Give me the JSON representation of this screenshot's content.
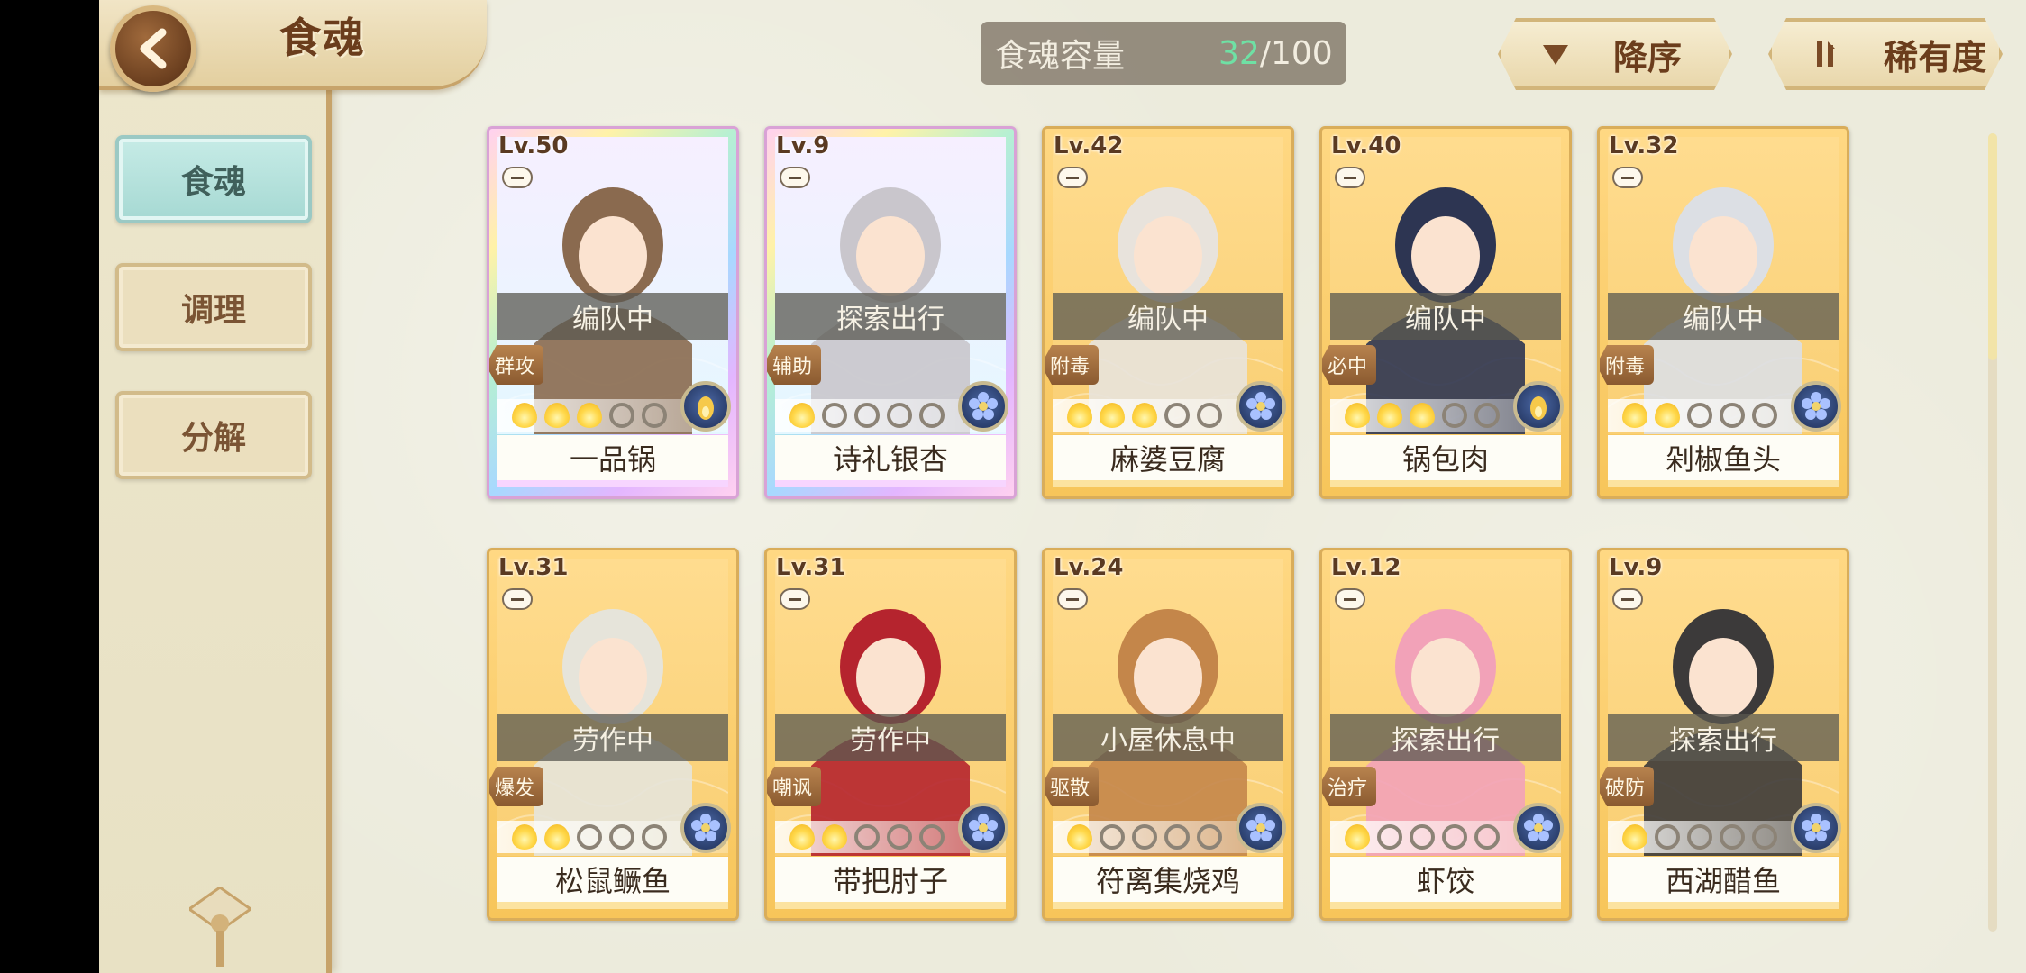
{
  "header": {
    "title": "食魂"
  },
  "sidebar": {
    "tabs": [
      {
        "label": "食魂",
        "active": true
      },
      {
        "label": "调理",
        "active": false
      },
      {
        "label": "分解",
        "active": false
      }
    ]
  },
  "capacity": {
    "label": "食魂容量",
    "current": "32",
    "separator": "/",
    "max": "100"
  },
  "toolbar": {
    "sort_order_label": "降序",
    "sort_order_icon": "triangle-down-icon",
    "sort_field_label": "稀有度",
    "sort_field_icon": "swap-vertical-icon"
  },
  "scrollbar": {
    "position": 0.0
  },
  "colors": {
    "accent_teal": "#a6d9d3",
    "gold": "#f7c55a",
    "brown_text": "#6b3d1c",
    "capacity_green": "#6fe0a4"
  },
  "cards": [
    {
      "level": "Lv.50",
      "status": "编队中",
      "role": "群攻",
      "stars": 3,
      "max_stars": 5,
      "name": "一品锅",
      "frame": "rainbow",
      "emblem": "flame-emblem-icon",
      "art_color": "#8a6a4f"
    },
    {
      "level": "Lv.9",
      "status": "探索出行",
      "role": "辅助",
      "stars": 1,
      "max_stars": 5,
      "name": "诗礼银杏",
      "frame": "rainbow",
      "emblem": "flower-emblem-icon",
      "art_color": "#c9c6cc"
    },
    {
      "level": "Lv.42",
      "status": "编队中",
      "role": "附毒",
      "stars": 3,
      "max_stars": 5,
      "name": "麻婆豆腐",
      "frame": "gold",
      "emblem": "flower-emblem-icon",
      "art_color": "#e8e3dc"
    },
    {
      "level": "Lv.40",
      "status": "编队中",
      "role": "必中",
      "stars": 3,
      "max_stars": 5,
      "name": "锅包肉",
      "frame": "gold",
      "emblem": "flame-emblem-icon",
      "art_color": "#2d3552"
    },
    {
      "level": "Lv.32",
      "status": "编队中",
      "role": "附毒",
      "stars": 2,
      "max_stars": 5,
      "name": "剁椒鱼头",
      "frame": "gold",
      "emblem": "flower-emblem-icon",
      "art_color": "#dcdfe4"
    },
    {
      "level": "Lv.31",
      "status": "劳作中",
      "role": "爆发",
      "stars": 2,
      "max_stars": 5,
      "name": "松鼠鳜鱼",
      "frame": "gold",
      "emblem": "flower-emblem-icon",
      "art_color": "#e6e4da"
    },
    {
      "level": "Lv.31",
      "status": "劳作中",
      "role": "嘲讽",
      "stars": 2,
      "max_stars": 5,
      "name": "带把肘子",
      "frame": "gold",
      "emblem": "flower-emblem-icon",
      "art_color": "#b5242e"
    },
    {
      "level": "Lv.24",
      "status": "小屋休息中",
      "role": "驱散",
      "stars": 1,
      "max_stars": 5,
      "name": "符离集烧鸡",
      "frame": "gold",
      "emblem": "flower-emblem-icon",
      "art_color": "#c4864a"
    },
    {
      "level": "Lv.12",
      "status": "探索出行",
      "role": "治疗",
      "stars": 1,
      "max_stars": 5,
      "name": "虾饺",
      "frame": "gold",
      "emblem": "flower-emblem-icon",
      "art_color": "#f2a2b8"
    },
    {
      "level": "Lv.9",
      "status": "探索出行",
      "role": "破防",
      "stars": 1,
      "max_stars": 5,
      "name": "西湖醋鱼",
      "frame": "gold",
      "emblem": "flower-emblem-icon",
      "art_color": "#3c3a3a"
    }
  ]
}
